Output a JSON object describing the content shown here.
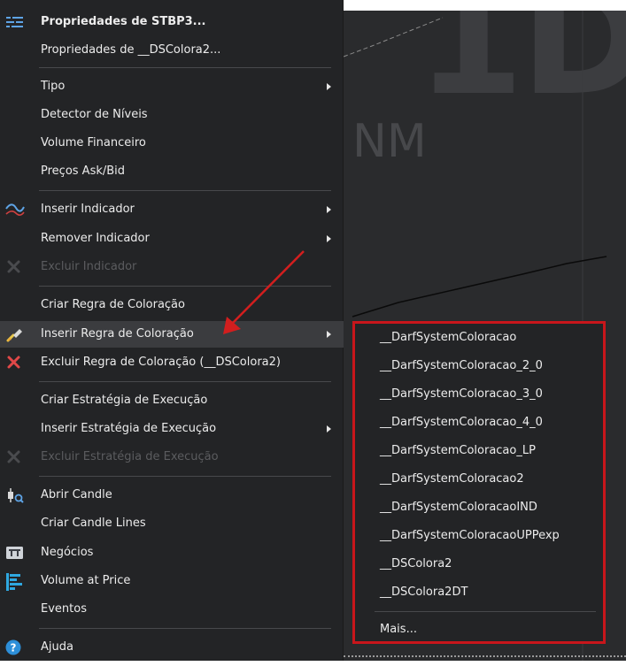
{
  "chart": {
    "watermark_big": "1D",
    "watermark_small": "NM"
  },
  "menu": {
    "items": [
      {
        "label": "Propriedades de STBP3...",
        "icon": "properties-icon"
      },
      {
        "label": "Propriedades de __DSColora2..."
      },
      {
        "label": "Tipo",
        "submenu": true
      },
      {
        "label": "Detector de Níveis"
      },
      {
        "label": "Volume Financeiro"
      },
      {
        "label": "Preços Ask/Bid"
      },
      {
        "label": "Inserir Indicador",
        "submenu": true,
        "icon": "indicator-wave-icon"
      },
      {
        "label": "Remover Indicador",
        "submenu": true
      },
      {
        "label": "Excluir Indicador",
        "disabled": true,
        "icon": "delete-x-icon"
      },
      {
        "label": "Criar Regra de Coloração"
      },
      {
        "label": "Inserir Regra de Coloração",
        "submenu": true,
        "icon": "paint-brush-icon"
      },
      {
        "label": "Excluir Regra de Coloração (__DSColora2)",
        "icon": "delete-x-icon"
      },
      {
        "label": "Criar Estratégia de Execução"
      },
      {
        "label": "Inserir Estratégia de Execução",
        "submenu": true
      },
      {
        "label": "Excluir Estratégia de Execução",
        "disabled": true,
        "icon": "delete-x-icon"
      },
      {
        "label": "Abrir Candle",
        "icon": "candle-icon"
      },
      {
        "label": "Criar Candle Lines"
      },
      {
        "label": "Negócios",
        "icon": "trades-icon"
      },
      {
        "label": "Volume at Price",
        "icon": "volume-at-price-icon"
      },
      {
        "label": "Eventos"
      },
      {
        "label": "Ajuda",
        "icon": "help-icon"
      }
    ]
  },
  "submenu": {
    "items": [
      "__DarfSystemColoracao",
      "__DarfSystemColoracao_2_0",
      "__DarfSystemColoracao_3_0",
      "__DarfSystemColoracao_4_0",
      "__DarfSystemColoracao_LP",
      "__DarfSystemColoracao2",
      "__DarfSystemColoracaoIND",
      "__DarfSystemColoracaoUPPexp",
      "__DSColora2",
      "__DSColora2DT"
    ],
    "more_label": "Mais..."
  },
  "colors": {
    "menu_bg": "#232426",
    "chart_bg": "#2a2b2d",
    "highlight": "#c8161b",
    "hover_bg": "#3b3c3f"
  }
}
